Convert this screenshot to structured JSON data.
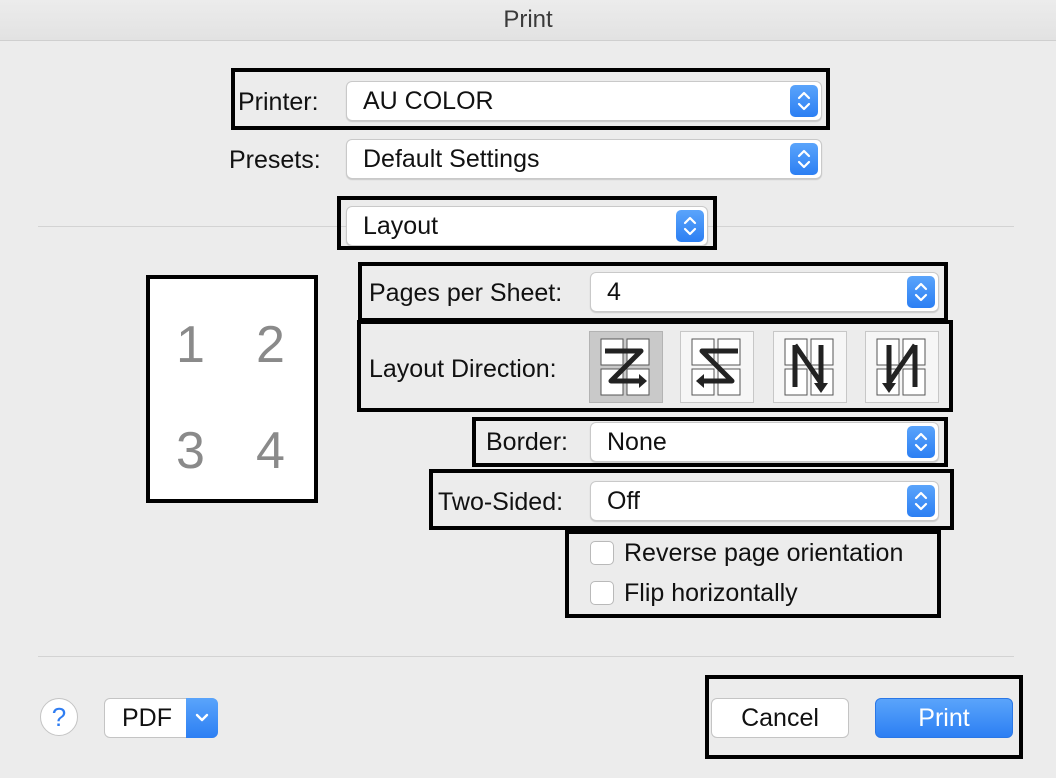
{
  "window": {
    "title": "Print"
  },
  "printer": {
    "label": "Printer:",
    "value": "AU COLOR"
  },
  "presets": {
    "label": "Presets:",
    "value": "Default Settings"
  },
  "section": {
    "value": "Layout"
  },
  "preview": {
    "pages": [
      "1",
      "2",
      "3",
      "4"
    ]
  },
  "pages_per_sheet": {
    "label": "Pages per Sheet:",
    "value": "4"
  },
  "layout_direction": {
    "label": "Layout Direction:",
    "options": [
      "z-pattern",
      "reverse-z-pattern",
      "n-pattern",
      "reverse-n-pattern"
    ],
    "selected_index": 0
  },
  "border": {
    "label": "Border:",
    "value": "None"
  },
  "two_sided": {
    "label": "Two-Sided:",
    "value": "Off"
  },
  "checkboxes": [
    {
      "label": "Reverse page orientation",
      "checked": false
    },
    {
      "label": "Flip horizontally",
      "checked": false
    }
  ],
  "footer": {
    "help": "?",
    "pdf_label": "PDF",
    "cancel_label": "Cancel",
    "print_label": "Print"
  },
  "colors": {
    "accent": "#2c7ff3",
    "frame": "#000000",
    "background": "#ececec"
  }
}
